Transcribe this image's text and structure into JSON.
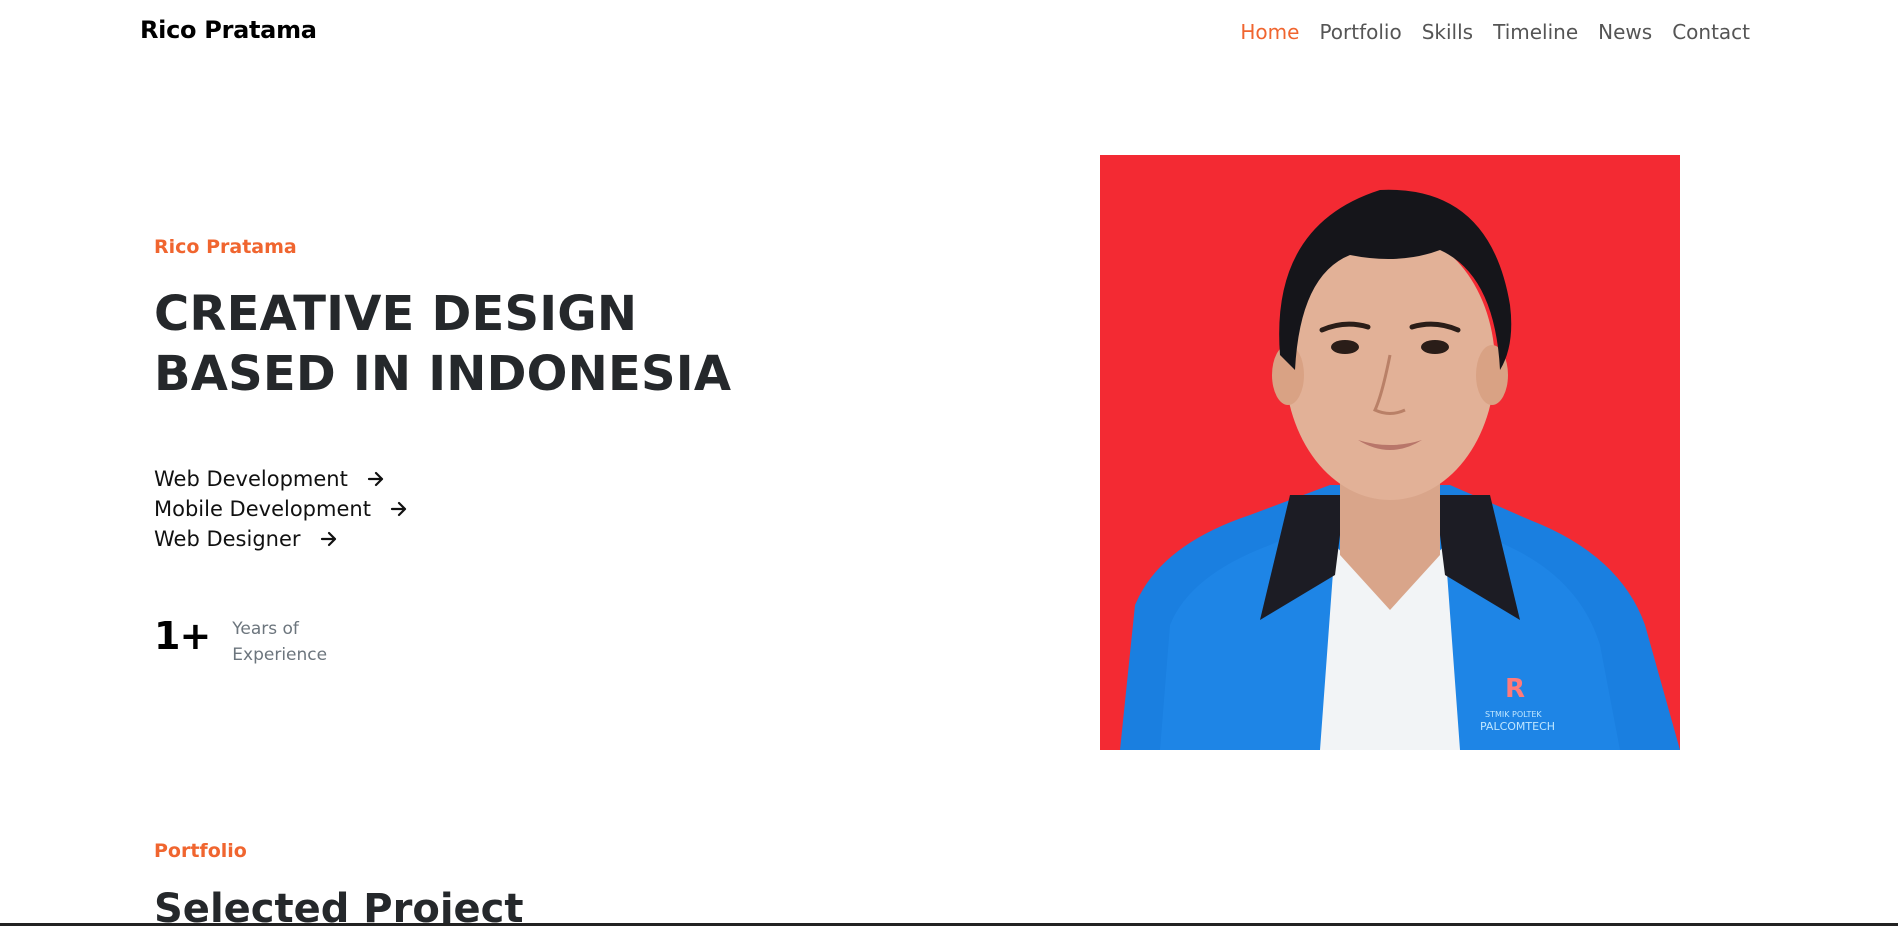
{
  "brand": "Rico Pratama",
  "nav": {
    "items": [
      {
        "label": "Home",
        "active": true
      },
      {
        "label": "Portfolio",
        "active": false
      },
      {
        "label": "Skills",
        "active": false
      },
      {
        "label": "Timeline",
        "active": false
      },
      {
        "label": "News",
        "active": false
      },
      {
        "label": "Contact",
        "active": false
      }
    ]
  },
  "hero": {
    "eyebrow": "Rico Pratama",
    "title_line1": "CREATIVE DESIGN",
    "title_line2": "BASED IN INDONESIA",
    "services": [
      {
        "label": "Web Development",
        "icon": "arrow-right-icon"
      },
      {
        "label": "Mobile Development",
        "icon": "arrow-right-icon"
      },
      {
        "label": "Web Designer",
        "icon": "arrow-right-icon"
      }
    ],
    "experience": {
      "number": "1+",
      "label_line1": "Years of",
      "label_line2": "Experience"
    },
    "photo": {
      "background_color": "#f32a33",
      "jacket_color": "#1a7fe0",
      "badge_text_line1": "STMIK POLTEK",
      "badge_text_line2": "PALCOMTECH"
    }
  },
  "portfolio": {
    "eyebrow": "Portfolio",
    "title": "Selected Project"
  },
  "colors": {
    "accent": "#f0652f",
    "heading": "#25282b",
    "muted": "#6c757d"
  }
}
